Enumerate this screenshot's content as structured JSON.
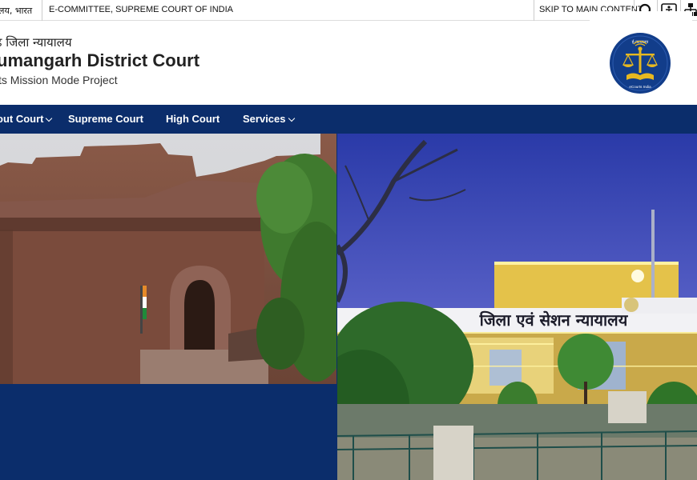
{
  "topbar": {
    "hindi_label": "लय, भारत",
    "ecommittee": "E-COMMITTEE, SUPREME COURT OF INDIA",
    "skip": "SKIP TO MAIN CONTENT"
  },
  "header": {
    "hindi_title": "ढ़ जिला न्यायालय",
    "title": "umangarh District Court",
    "subtitle": "ts Mission Mode Project"
  },
  "logo": {
    "top_text": "ई-न्यायालय",
    "bottom_text": "eCourts India"
  },
  "nav": {
    "items": [
      {
        "label": "out Court"
      },
      {
        "label": "Supreme Court"
      },
      {
        "label": "High Court"
      },
      {
        "label": "Services"
      }
    ]
  },
  "slide": {
    "sign_text": "जिला एवं सेशन न्यायालय"
  },
  "colors": {
    "nav_bg": "#0b2d6b",
    "logo_bg": "#123d8a",
    "logo_gold": "#e7b820"
  }
}
